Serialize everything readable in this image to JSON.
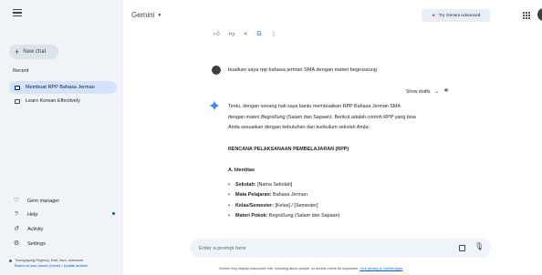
{
  "sidebar": {
    "new_chat": "New chat",
    "recent_label": "Recent",
    "recent_items": [
      {
        "label": "Membuat RPP Bahasa Jerman",
        "active": true
      },
      {
        "label": "Learn Korean Effectively",
        "active": false
      }
    ],
    "bottom_items": [
      {
        "label": "Gem manager",
        "icon": "gem-icon"
      },
      {
        "label": "Help",
        "icon": "help-icon"
      },
      {
        "label": "Activity",
        "icon": "history-icon"
      },
      {
        "label": "Settings",
        "icon": "gear-icon"
      }
    ],
    "location": {
      "place": "Tulungagung Regency, East Java, Indonesia",
      "source": "Based on your places (Home) • Update location"
    }
  },
  "header": {
    "title": "Gemini",
    "try_advanced": "Try Gemini Advanced"
  },
  "conversation": {
    "user_prompt": "buatkan saya rpp bahasa jerman SMA dengan materi begrussung",
    "show_drafts": "Show drafts",
    "response": {
      "intro_1": "Tentu, dengan senang hati saya bantu membuatkan RPP Bahasa Jerman SMA",
      "intro_2a": "dengan materi ",
      "intro_2b": "Begrüßung",
      "intro_2c": " (Salam dan Sapaan). Berikut adalah contoh RPP yang bisa",
      "intro_3": "Anda sesuaikan dengan kebutuhan dan kurikulum sekolah Anda:",
      "heading": "RENCANA PELAKSANAAN PEMBELAJARAN (RPP)",
      "section": "A. Identitas",
      "items": [
        {
          "label": "Sekolah:",
          "value": " [Nama Sekolah]"
        },
        {
          "label": "Mata Pelajaran:",
          "value": " Bahasa Jerman"
        },
        {
          "label": "Kelas/Semester:",
          "value": " [Kelas] / [Semester]"
        },
        {
          "label": "Materi Pokok:",
          "value": " Begrüßung (Salam dan Sapaan)"
        }
      ]
    }
  },
  "prompt": {
    "placeholder": "Enter a prompt here"
  },
  "footer": {
    "disclaimer": "Gemini may display inaccurate info, including about people, so double-check its responses. ",
    "privacy_link": "Your privacy & Gemini Apps"
  },
  "colors": {
    "sidebar_bg": "#f0f4f9",
    "active_item_bg": "#d3e3fd",
    "accent_blue": "#0b57d0"
  }
}
